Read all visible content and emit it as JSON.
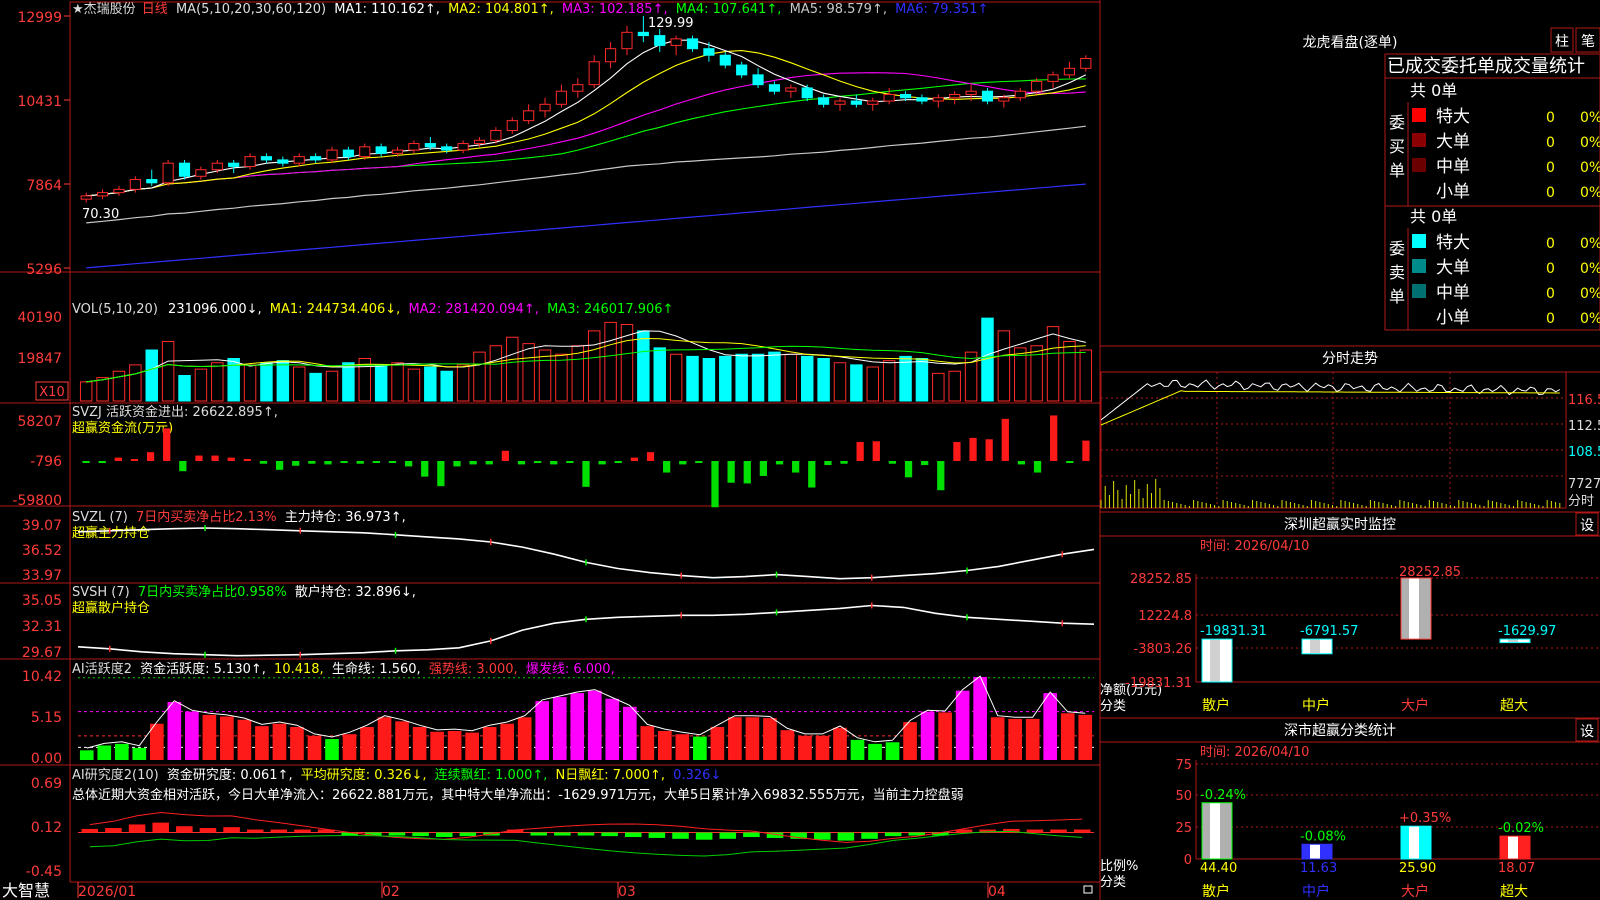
{
  "app": {
    "logo": "大智慧"
  },
  "colors": {
    "up": "#ff2a2a",
    "down": "#00ffff",
    "grid": "#b01818",
    "ma1": "#ffffff",
    "ma2": "#ffff00",
    "ma3": "#ff00ff",
    "ma4": "#00ff00",
    "ma5": "#c8c8c8",
    "ma6": "#3030ff"
  },
  "price_panel": {
    "header_prefix": "★杰瑞股份",
    "period": "日线",
    "ma_header": "MA(5,10,20,30,60,120)",
    "ma_labels": [
      "MA1: 110.162↑,",
      "MA2: 104.801↑,",
      "MA3: 102.185↑,",
      "MA4: 107.641↑,",
      "MA5: 98.579↑,",
      "MA6: 79.351↑"
    ],
    "axis": [
      "12999",
      "10431",
      "7864",
      "5296"
    ],
    "high_label": "129.99",
    "low_label": "70.30"
  },
  "vol_panel": {
    "header": "VOL(5,10,20)",
    "labels": [
      "231096.000↓,",
      "MA1: 244734.406↓,",
      "MA2: 281420.094↑,",
      "MA3: 246017.906↑"
    ],
    "axis": [
      "40190",
      "19847"
    ],
    "unit": "X10"
  },
  "svzj_panel": {
    "header": "SVZJ  活跃资金进出: 26622.895↑,",
    "subtitle": "超赢资金流(万元)",
    "axis": [
      "58207",
      "-796",
      "-59800"
    ]
  },
  "svzl_panel": {
    "header_a": "SVZL (7)",
    "header_b": "7日内买卖净占比2.13%",
    "header_c": "主力持仓: 36.973↑,",
    "subtitle": "超赢主力持仓",
    "axis": [
      "39.07",
      "36.52",
      "33.97"
    ]
  },
  "svsh_panel": {
    "header_a": "SVSH (7)",
    "header_b": "7日内买卖净占比0.958%",
    "header_c": "散户持仓: 32.896↓,",
    "subtitle": "超赢散户持仓",
    "axis": [
      "35.05",
      "32.31",
      "29.67"
    ]
  },
  "ai_act_panel": {
    "labels": [
      "AI活跃度2",
      "资金活跃度: 5.130↑,",
      "10.418,",
      "生命线: 1.560,",
      "强势线: 3.000,",
      "爆发线: 6.000,"
    ],
    "axis": [
      "10.42",
      "5.15",
      "0.00"
    ]
  },
  "ai_res_panel": {
    "labels": [
      "AI研究度2(10)",
      "资金研究度: 0.061↑,",
      "平均研究度: 0.326↓,",
      "连续飘红: 1.000↑,",
      "N日飘红: 7.000↑,",
      "0.326↓"
    ],
    "summary": "总体近期大资金相对活跃，今日大单净流入：26622.881万元，其中特大单净流出：-1629.971万元，大单5日累计净入69832.555万元，当前主力控盘弱",
    "axis": [
      "0.69",
      "0.12",
      "-0.45"
    ]
  },
  "x_axis": {
    "labels": [
      "2026/01",
      "02",
      "03",
      "04"
    ]
  },
  "lhb": {
    "title": "龙虎看盘(逐单)",
    "btn_bar": "柱",
    "btn_pen": "笔",
    "tabs": "已成交委托单成交量统计",
    "buy_group": "委买单",
    "sell_group": "委卖单",
    "buy_total": "共 0单",
    "sell_total": "共 0单",
    "buy_rows": [
      {
        "label": "特大",
        "count": "0",
        "pct": "0%",
        "color": "#ff0000"
      },
      {
        "label": "大单",
        "count": "0",
        "pct": "0%",
        "color": "#8b0000"
      },
      {
        "label": "中单",
        "count": "0",
        "pct": "0%",
        "color": "#6a0000"
      },
      {
        "label": "小单",
        "count": "0",
        "pct": "0%",
        "color": ""
      }
    ],
    "sell_rows": [
      {
        "label": "特大",
        "count": "0",
        "pct": "0%",
        "color": "#00ffff"
      },
      {
        "label": "大单",
        "count": "0",
        "pct": "0%",
        "color": "#008b8b"
      },
      {
        "label": "中单",
        "count": "0",
        "pct": "0%",
        "color": "#007070"
      },
      {
        "label": "小单",
        "count": "0",
        "pct": "0%",
        "color": ""
      }
    ]
  },
  "intraday": {
    "title": "分时走势",
    "axis": [
      "116.5",
      "112.5",
      "108.5",
      "7727"
    ],
    "footer": "分时"
  },
  "sz_monitor": {
    "title": "深圳超赢实时监控",
    "set_btn": "设",
    "time_label": "时间: 2026/04/10",
    "axis": [
      "28252.85",
      "12224.8",
      "-3803.26",
      "-19831.31"
    ],
    "ylabel": [
      "净额(万元)",
      "分类"
    ],
    "categories": [
      "散户",
      "中户",
      "大户",
      "超大"
    ],
    "values": [
      -19831.31,
      -6791.57,
      28252.85,
      -1629.97
    ],
    "value_labels": [
      "-19831.31",
      "-6791.57",
      "28252.85",
      "-1629.97"
    ],
    "ylim": [
      -19831.31,
      28252.85
    ]
  },
  "sz_class": {
    "title": "深市超赢分类统计",
    "set_btn": "设",
    "time_label": "时间: 2026/04/10",
    "axis": [
      "75",
      "50",
      "25",
      "0"
    ],
    "ylabel": [
      "比例%",
      "分类"
    ],
    "categories": [
      "散户",
      "中户",
      "大户",
      "超大"
    ],
    "values": [
      44.4,
      11.63,
      25.9,
      18.07
    ],
    "value_labels": [
      "44.40",
      "11.63",
      "25.90",
      "18.07"
    ],
    "change_labels": [
      "-0.24%",
      "-0.08%",
      "+0.35%",
      "-0.02%"
    ],
    "ylim": [
      0,
      75
    ]
  },
  "chart_data": [
    {
      "type": "candlestick",
      "title": "★杰瑞股份 日线",
      "x": [
        "2026/01",
        "02",
        "03",
        "04"
      ],
      "ylim": [
        52.96,
        129.99
      ],
      "ohlc": [
        [
          74,
          76,
          73,
          75
        ],
        [
          75,
          77,
          74,
          76
        ],
        [
          76,
          78,
          75,
          77
        ],
        [
          77,
          81,
          76,
          80
        ],
        [
          80,
          83,
          78,
          79
        ],
        [
          79,
          86,
          78,
          85
        ],
        [
          85,
          86,
          80,
          81
        ],
        [
          81,
          84,
          80,
          83
        ],
        [
          83,
          86,
          82,
          85
        ],
        [
          85,
          86,
          82,
          84
        ],
        [
          84,
          88,
          83,
          87
        ],
        [
          87,
          88,
          85,
          86
        ],
        [
          86,
          87,
          84,
          85
        ],
        [
          85,
          88,
          84,
          87
        ],
        [
          87,
          88,
          85,
          86
        ],
        [
          86,
          90,
          85,
          89
        ],
        [
          89,
          90,
          86,
          87
        ],
        [
          87,
          91,
          86,
          90
        ],
        [
          90,
          91,
          87,
          88
        ],
        [
          88,
          90,
          87,
          89
        ],
        [
          89,
          92,
          88,
          91
        ],
        [
          91,
          93,
          89,
          90
        ],
        [
          90,
          91,
          88,
          89
        ],
        [
          89,
          92,
          88,
          91
        ],
        [
          91,
          93,
          90,
          92
        ],
        [
          92,
          96,
          91,
          95
        ],
        [
          95,
          99,
          94,
          98
        ],
        [
          98,
          103,
          97,
          101
        ],
        [
          101,
          105,
          99,
          103
        ],
        [
          103,
          109,
          102,
          107
        ],
        [
          107,
          111,
          105,
          109
        ],
        [
          109,
          118,
          108,
          116
        ],
        [
          116,
          122,
          114,
          120
        ],
        [
          120,
          127,
          118,
          125
        ],
        [
          125,
          130,
          122,
          124
        ],
        [
          124,
          126,
          119,
          121
        ],
        [
          121,
          124,
          118,
          123
        ],
        [
          123,
          124,
          119,
          120
        ],
        [
          120,
          122,
          116,
          118
        ],
        [
          118,
          119,
          114,
          115
        ],
        [
          115,
          116,
          111,
          112
        ],
        [
          112,
          114,
          108,
          109
        ],
        [
          109,
          110,
          106,
          107
        ],
        [
          107,
          109,
          105,
          108
        ],
        [
          108,
          109,
          104,
          105
        ],
        [
          105,
          106,
          102,
          103
        ],
        [
          103,
          105,
          101,
          104
        ],
        [
          104,
          106,
          102,
          103
        ],
        [
          103,
          105,
          101,
          104
        ],
        [
          104,
          108,
          103,
          106
        ],
        [
          106,
          107,
          104,
          105
        ],
        [
          105,
          106,
          103,
          104
        ],
        [
          104,
          106,
          102,
          105
        ],
        [
          105,
          107,
          103,
          106
        ],
        [
          106,
          109,
          104,
          107
        ],
        [
          107,
          108,
          103,
          104
        ],
        [
          104,
          106,
          102,
          105
        ],
        [
          105,
          108,
          104,
          107
        ],
        [
          107,
          111,
          106,
          110
        ],
        [
          110,
          113,
          108,
          112
        ],
        [
          112,
          116,
          111,
          114
        ],
        [
          114,
          118,
          113,
          117
        ]
      ]
    },
    {
      "type": "bar",
      "title": "VOL(5,10,20)",
      "values": [
        9,
        11,
        14,
        17,
        24,
        28,
        12,
        15,
        18,
        20,
        17,
        18,
        19,
        16,
        13,
        14,
        18,
        20,
        17,
        18,
        15,
        16,
        14,
        17,
        23,
        26,
        30,
        27,
        24,
        22,
        26,
        33,
        37,
        36,
        33,
        25,
        22,
        21,
        20,
        21,
        22,
        22,
        23,
        22,
        21,
        20,
        18,
        17,
        16,
        19,
        21,
        20,
        13,
        14,
        23,
        39,
        33,
        25,
        26,
        35,
        28,
        24
      ],
      "ylim": [
        0,
        40190
      ]
    },
    {
      "type": "bar",
      "title": "SVZJ",
      "values": [
        -0.2,
        -0.3,
        0.5,
        0.2,
        1.3,
        4.8,
        -1.5,
        0.8,
        0.8,
        0.5,
        0.2,
        -0.4,
        -1.3,
        -0.7,
        -0.4,
        -0.5,
        -0.3,
        -0.4,
        -0.3,
        -0.2,
        -0.8,
        -2.3,
        -3.7,
        -0.8,
        -0.5,
        -0.5,
        1.5,
        -0.5,
        -0.3,
        -0.5,
        -0.3,
        -3.8,
        -0.5,
        -0.3,
        0.5,
        1.3,
        -1.7,
        -0.5,
        -0.3,
        -6.8,
        -3.2,
        -3.3,
        -2.2,
        -0.5,
        -1.7,
        -3.9,
        -0.6,
        -0.4,
        2.8,
        2.9,
        -0.4,
        -2.4,
        -0.6,
        -4.3,
        2.8,
        3.4,
        3.2,
        6.2,
        -0.5,
        -1.7,
        6.7,
        -0.3,
        3.0
      ],
      "ylim": [
        -59800,
        58207
      ]
    },
    {
      "type": "line",
      "title": "SVZL (7)",
      "values": [
        38.7,
        38.8,
        38.9,
        39.0,
        39.07,
        39.0,
        38.9,
        38.8,
        38.7,
        38.6,
        38.4,
        38.2,
        38.0,
        37.7,
        37.2,
        36.5,
        35.7,
        35.1,
        34.7,
        34.4,
        34.2,
        34.3,
        34.5,
        34.3,
        34.1,
        34.2,
        34.4,
        34.6,
        34.9,
        35.3,
        35.9,
        36.5,
        36.97
      ],
      "ylim": [
        33.97,
        39.07
      ]
    },
    {
      "type": "line",
      "title": "SVSH (7)",
      "values": [
        30.6,
        30.4,
        30.1,
        29.9,
        29.8,
        29.7,
        29.75,
        29.8,
        29.9,
        30.0,
        30.2,
        30.3,
        30.5,
        31.2,
        32.3,
        33.0,
        33.4,
        33.6,
        33.7,
        33.8,
        33.8,
        33.9,
        34.1,
        34.3,
        34.5,
        34.8,
        34.6,
        34.0,
        33.6,
        33.4,
        33.2,
        33.0,
        32.896
      ],
      "ylim": [
        29.67,
        35.05
      ]
    },
    {
      "type": "bar",
      "title": "AI活跃度2",
      "values": [
        1.2,
        1.8,
        2.0,
        1.5,
        4.5,
        7.2,
        6.0,
        5.6,
        5.4,
        5.0,
        4.2,
        4.5,
        4.1,
        3.0,
        2.6,
        3.2,
        4.1,
        5.3,
        4.8,
        4.1,
        3.5,
        3.6,
        3.4,
        4.1,
        4.5,
        5.3,
        7.3,
        7.8,
        8.3,
        8.6,
        7.6,
        6.6,
        4.2,
        3.6,
        3.2,
        2.9,
        4.1,
        5.3,
        5.3,
        5.2,
        3.7,
        3.0,
        3.0,
        4.0,
        2.5,
        2.0,
        2.2,
        4.7,
        6.0,
        5.9,
        8.6,
        10.3,
        5.3,
        5.1,
        5.1,
        8.3,
        5.8,
        5.6
      ],
      "ylim": [
        0,
        10.42
      ]
    },
    {
      "type": "bar",
      "title": "AI研究度2(10)",
      "values": [
        0.09,
        0.1,
        0.14,
        0.16,
        0.12,
        0.1,
        0.11,
        0.08,
        0.07,
        0.06,
        0.05,
        0.04,
        0.03,
        0.02,
        0.01,
        0.0,
        0.01,
        0.03,
        0.05,
        0.04,
        0.03,
        0.02,
        0.01,
        0.0,
        -0.01,
        -0.02,
        -0.03,
        -0.02,
        0.0,
        -0.01,
        -0.02,
        -0.03,
        -0.04,
        -0.02,
        0.01,
        0.02,
        0.04,
        0.06,
        0.08,
        0.09,
        0.07,
        0.06,
        0.061
      ],
      "ylim": [
        -0.45,
        0.69
      ]
    }
  ]
}
